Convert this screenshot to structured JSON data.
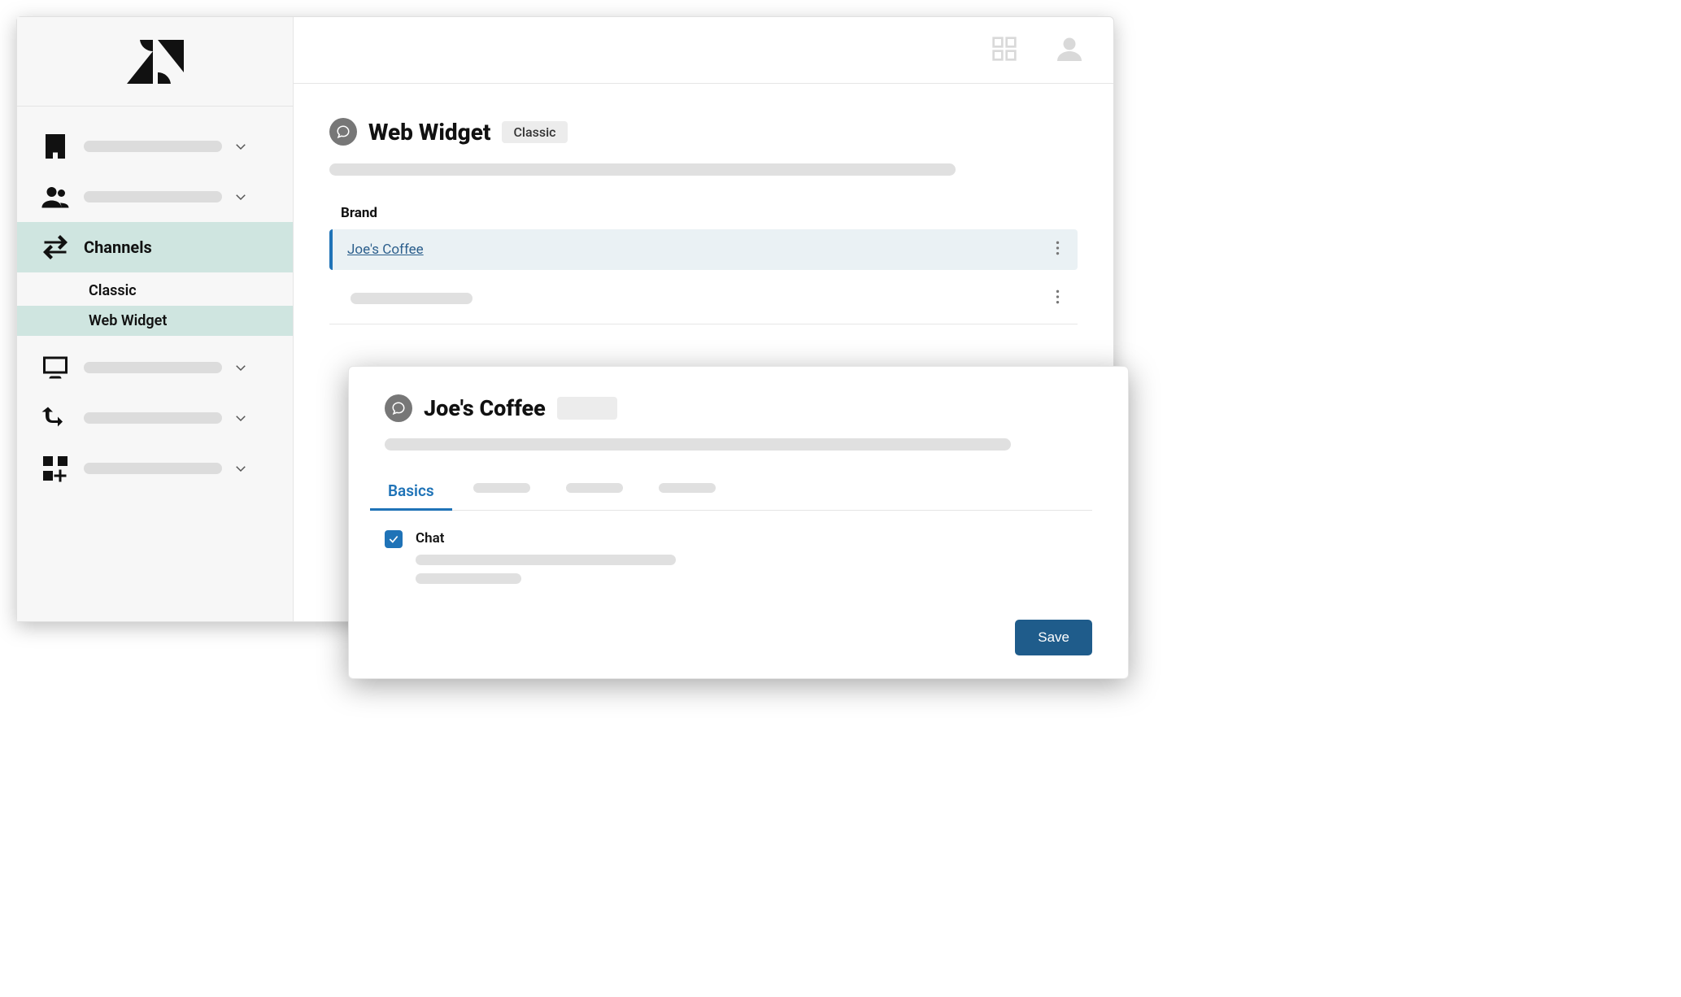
{
  "sidebar": {
    "items": [
      {
        "icon": "building",
        "label": null
      },
      {
        "icon": "people",
        "label": null
      },
      {
        "icon": "arrows",
        "label": "Channels",
        "children": [
          {
            "label": "Classic"
          },
          {
            "label": "Web Widget",
            "active": true
          }
        ]
      },
      {
        "icon": "monitor",
        "label": null
      },
      {
        "icon": "route",
        "label": null
      },
      {
        "icon": "apps-add",
        "label": null
      }
    ]
  },
  "page": {
    "title": "Web Widget",
    "tag": "Classic",
    "section": "Brand",
    "brands": [
      {
        "name": "Joe's Coffee",
        "active": true
      },
      {
        "name": null,
        "active": false
      }
    ]
  },
  "panel": {
    "title": "Joe's Coffee",
    "tabs": [
      {
        "label": "Basics",
        "active": true
      },
      {
        "label": null
      },
      {
        "label": null
      },
      {
        "label": null
      }
    ],
    "option": {
      "checked": true,
      "label": "Chat"
    },
    "saveLabel": "Save"
  }
}
